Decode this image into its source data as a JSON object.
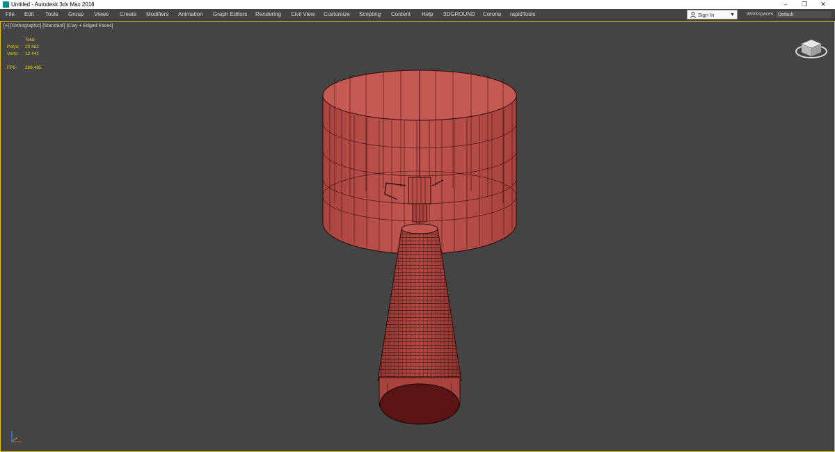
{
  "window": {
    "title": "Untitled - Autodesk 3ds Max 2018",
    "controls": [
      "–",
      "❐",
      "✕"
    ]
  },
  "menu": {
    "items": [
      "File",
      "Edit",
      "Tools",
      "Group",
      "Views",
      "Create",
      "Modifiers",
      "Animation",
      "Graph Editors",
      "Rendering",
      "Civil View",
      "Customize",
      "Scripting",
      "Content",
      "Help",
      "3DGROUND",
      "Corona",
      "rapidTools"
    ],
    "sign_in": "Sign In",
    "workspaces_label": "Workspaces:",
    "workspace_value": "Default"
  },
  "viewport": {
    "label": "[+] [Orthographic] [Standard] [Clay + Edged Faces]",
    "stats": {
      "header": "Total",
      "polys_label": "Polys:",
      "polys_value": "23 482",
      "verts_label": "Verts:",
      "verts_value": "12 441",
      "fps_label": "FPS:",
      "fps_value": "268,485"
    }
  },
  "colors": {
    "viewport_bg": "#444444",
    "viewport_border": "#f0c419",
    "stats_text": "#e8d400",
    "clay": "#b84c47",
    "edge": "#2a0808"
  },
  "icons": {
    "viewcube": "viewcube-icon",
    "axis": "axis-tripod-icon",
    "user": "user-icon"
  }
}
